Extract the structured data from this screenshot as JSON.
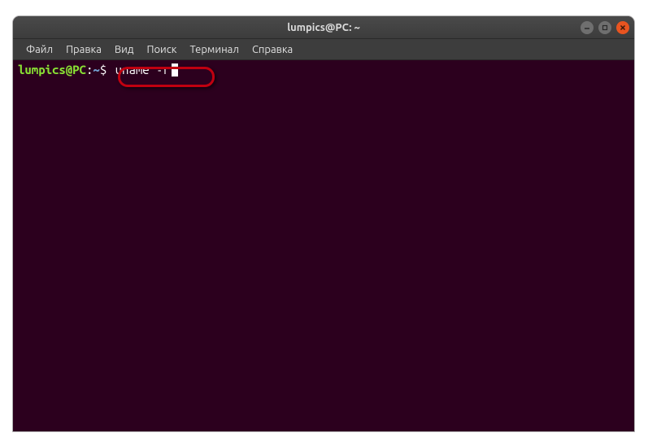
{
  "window": {
    "title": "lumpics@PC: ~"
  },
  "menu": {
    "items": [
      "Файл",
      "Правка",
      "Вид",
      "Поиск",
      "Терминал",
      "Справка"
    ]
  },
  "terminal": {
    "prompt_user_host": "lumpics@PC",
    "prompt_colon": ":",
    "prompt_path": "~",
    "prompt_dollar": "$ ",
    "command": "uname -r"
  }
}
